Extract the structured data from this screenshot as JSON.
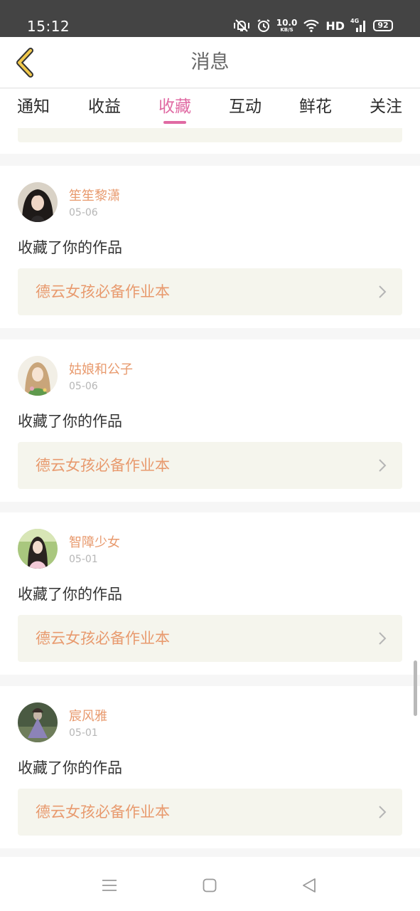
{
  "status_bar": {
    "time": "15:12",
    "net_speed": "10.0",
    "net_speed_unit": "KB/S",
    "hd": "HD",
    "network": "4G",
    "battery": "92"
  },
  "header": {
    "title": "消息"
  },
  "tabs": [
    {
      "label": "通知",
      "active": false
    },
    {
      "label": "收益",
      "active": false
    },
    {
      "label": "收藏",
      "active": true
    },
    {
      "label": "互动",
      "active": false
    },
    {
      "label": "鲜花",
      "active": false
    },
    {
      "label": "关注",
      "active": false
    }
  ],
  "messages": [
    {
      "user": "笙笙黎潇",
      "date": "05-06",
      "action": "收藏了你的作品",
      "work": "德云女孩必备作业本",
      "avatar_icon": "dark-hair-girl-avatar"
    },
    {
      "user": "姑娘和公子",
      "date": "05-06",
      "action": "收藏了你的作品",
      "work": "德云女孩必备作业本",
      "avatar_icon": "illustrated-girl-avatar"
    },
    {
      "user": "智障少女",
      "date": "05-01",
      "action": "收藏了你的作品",
      "work": "德云女孩必备作业本",
      "avatar_icon": "outdoor-girl-avatar"
    },
    {
      "user": "宸风雅",
      "date": "05-01",
      "action": "收藏了你的作品",
      "work": "德云女孩必备作业本",
      "avatar_icon": "purple-dress-avatar"
    }
  ],
  "colors": {
    "accent": "#e06aa3",
    "username": "#e89a6e",
    "work_bg": "#f5f5ed",
    "back_arrow": "#f2c94c"
  }
}
